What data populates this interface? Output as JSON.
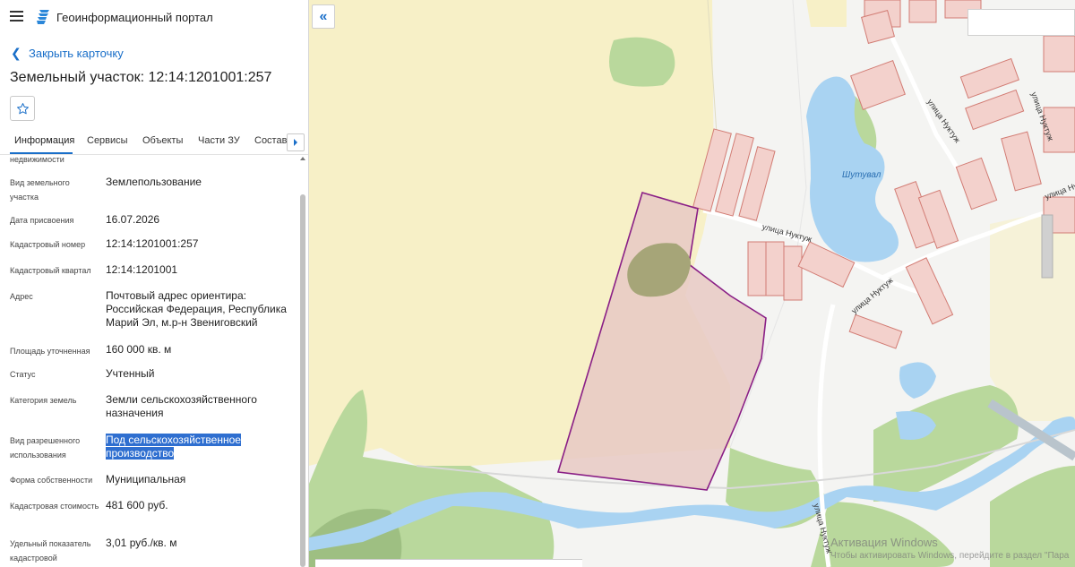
{
  "header": {
    "menu_icon": "hamburger-menu-icon",
    "logo_icon": "portal-logo-icon",
    "app_title": "Геоинформационный портал"
  },
  "card": {
    "close_label": "Закрыть карточку",
    "title": "Земельный участок: 12:14:1201001:257",
    "favorite_icon": "star-icon"
  },
  "tabs": [
    {
      "label": "Информация",
      "active": true
    },
    {
      "label": "Сервисы",
      "active": false
    },
    {
      "label": "Объекты",
      "active": false
    },
    {
      "label": "Части ЗУ",
      "active": false
    },
    {
      "label": "Состав",
      "active": false
    }
  ],
  "properties": [
    {
      "label": "недвижимости",
      "value": ""
    },
    {
      "label": "Вид земельного участка",
      "value": "Землепользование"
    },
    {
      "label": "Дата присвоения",
      "value": "16.07.2026"
    },
    {
      "label": "Кадастровый номер",
      "value": "12:14:1201001:257"
    },
    {
      "label": "Кадастровый квартал",
      "value": "12:14:1201001"
    },
    {
      "label": "Адрес",
      "value": "Почтовый адрес ориентира: Российская Федерация, Республика Марий Эл, м.р-н Звениговский"
    },
    {
      "label": "Площадь уточненная",
      "value": "160 000 кв. м"
    },
    {
      "label": "Статус",
      "value": "Учтенный"
    },
    {
      "label": "Категория земель",
      "value": "Земли сельскохозяйственного назначения"
    },
    {
      "label": "Вид разрешенного использования",
      "value": "Под сельскохозяйственное производство",
      "highlighted": true
    },
    {
      "label": "Форма собственности",
      "value": "Муниципальная"
    },
    {
      "label": "Кадастровая стоимость",
      "value": "481 600 руб."
    },
    {
      "label": "Удельный показатель кадастровой",
      "value": "3,01 руб./кв. м"
    }
  ],
  "map": {
    "collapse_icon": "double-chevron-left-icon",
    "streets": [
      "улица Нуктуж",
      "улица Нуктуж",
      "улица Нуктуж",
      "улица Нуктуж",
      "улица Нуктуж",
      "улица Нуктуж"
    ],
    "place_name": "Шутувал",
    "colors": {
      "field": "#f7f0c7",
      "forest": "#b9d89c",
      "water": "#a9d3f2",
      "parcel_fill": "#e8c9c4",
      "parcel_stroke": "#8a1f86",
      "buildings": "#f3d1cc"
    }
  },
  "watermark": {
    "line1": "Активация Windows",
    "line2": "Чтобы активировать Windows, перейдите в раздел \"Пара"
  }
}
